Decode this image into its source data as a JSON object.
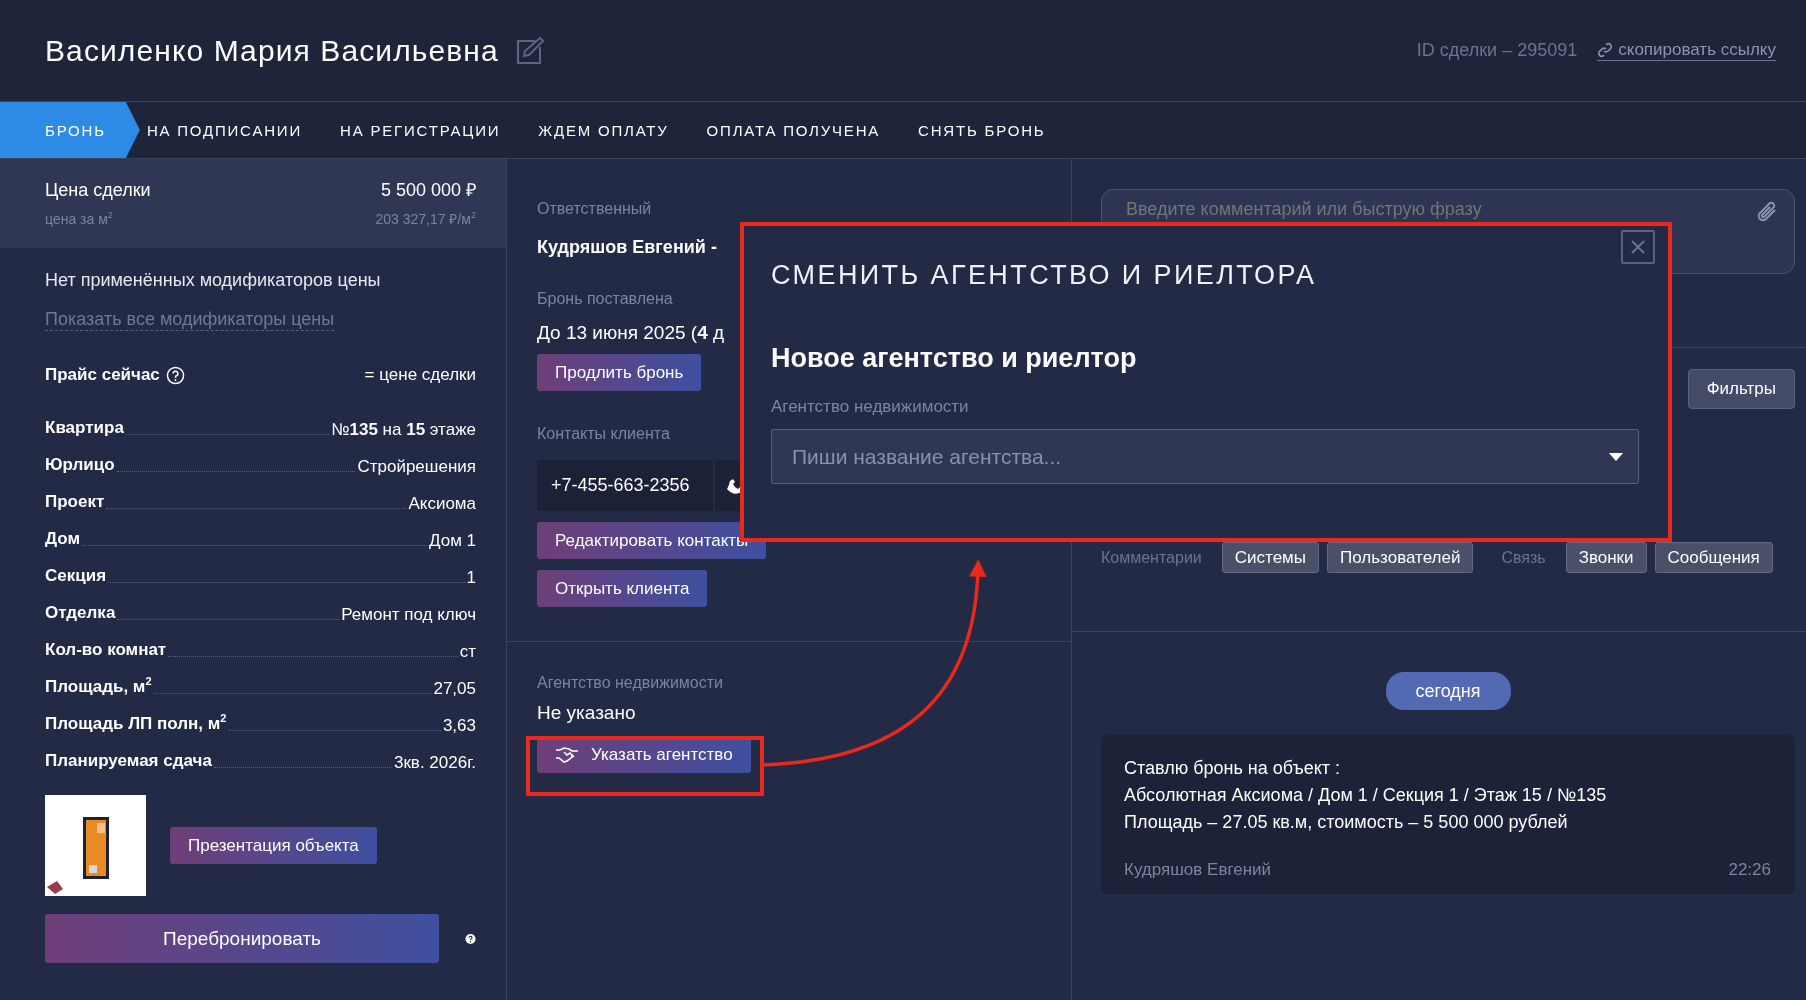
{
  "header": {
    "title": "Василенко Мария Васильевна",
    "deal_id": "ID сделки – 295091",
    "copy_link": "скопировать ссылку"
  },
  "tabs": [
    {
      "label": "БРОНЬ",
      "selected": true
    },
    {
      "label": "НА ПОДПИСАНИИ",
      "selected": false
    },
    {
      "label": "НА РЕГИСТРАЦИИ",
      "selected": false
    },
    {
      "label": "ЖДЕМ ОПЛАТУ",
      "selected": false
    },
    {
      "label": "ОПЛАТА ПОЛУЧЕНА",
      "selected": false
    },
    {
      "label": "СНЯТЬ БРОНЬ",
      "selected": false
    }
  ],
  "price": {
    "label": "Цена сделки",
    "value": "5 500 000 ₽",
    "per_m2_label": "цена за м$^{2}$",
    "per_m2_value": "203 327,17 ₽/м$^{2}$"
  },
  "modifiers": {
    "text": "Нет применённых модификаторов цены",
    "link": "Показать все модификаторы цены"
  },
  "price_now": {
    "label": "Прайс сейчас",
    "value": "= цене сделки"
  },
  "details": [
    {
      "label": "Квартира",
      "value": "№**135** на **15** этаже"
    },
    {
      "label": "Юрлицо",
      "value": "Стройрешения"
    },
    {
      "label": "Проект",
      "value": "Аксиома"
    },
    {
      "label": "Дом",
      "value": "Дом 1"
    },
    {
      "label": "Секция",
      "value": "1"
    },
    {
      "label": "Отделка",
      "value": "Ремонт под ключ"
    },
    {
      "label": "Кол-во комнат",
      "value": "ст"
    },
    {
      "label": "Площадь, м$^{2}$",
      "value": "27,05"
    },
    {
      "label": "Площадь ЛП полн, м$^{2}$",
      "value": "3,63"
    },
    {
      "label": "Планируемая сдача",
      "value": "3кв. 2026г."
    }
  ],
  "presentation_button": "Презентация объекта",
  "rebook_button": "Перебронировать",
  "middle": {
    "responsible_label": "Ответственный",
    "responsible_name": "Кудряшов Евгений -",
    "booking_label": "Бронь поставлена",
    "booking_date": "До 13 июня 2025 (**4** д",
    "extend_button": "Продлить бронь",
    "contacts_label": "Контакты клиента",
    "phone": "+7-455-663-2356",
    "edit_contacts_button": "Редактировать контакты",
    "open_client_button": "Открыть клиента",
    "agency_label": "Агентство недвижимости",
    "agency_value": "Не указано",
    "set_agency_button": "Указать агентство"
  },
  "comments": {
    "placeholder": "Введите комментарий или быструю фразу",
    "filters_button": "Фильтры",
    "filter_groups": [
      {
        "label": "Комментарии",
        "chips": [
          "Системы",
          "Пользователей"
        ]
      },
      {
        "label": "Связь",
        "chips": [
          "Звонки",
          "Сообщения"
        ]
      }
    ]
  },
  "feed": {
    "date_pill": "сегодня",
    "messages": [
      {
        "lines": [
          "Ставлю бронь на объект :",
          "Абсолютная Аксиома / Дом 1 / Секция 1 / Этаж 15 / №135",
          "Площадь – 27.05 кв.м, стоимость – 5 500 000 рублей"
        ],
        "author": "Кудряшов Евгений",
        "time": "22:26"
      }
    ]
  },
  "modal": {
    "title": "СМЕНИТЬ АГЕНТСТВО И РИЕЛТОРА",
    "subtitle": "Новое агентство и риелтор",
    "field_label": "Агентство недвижимости",
    "placeholder": "Пиши название агентства..."
  }
}
